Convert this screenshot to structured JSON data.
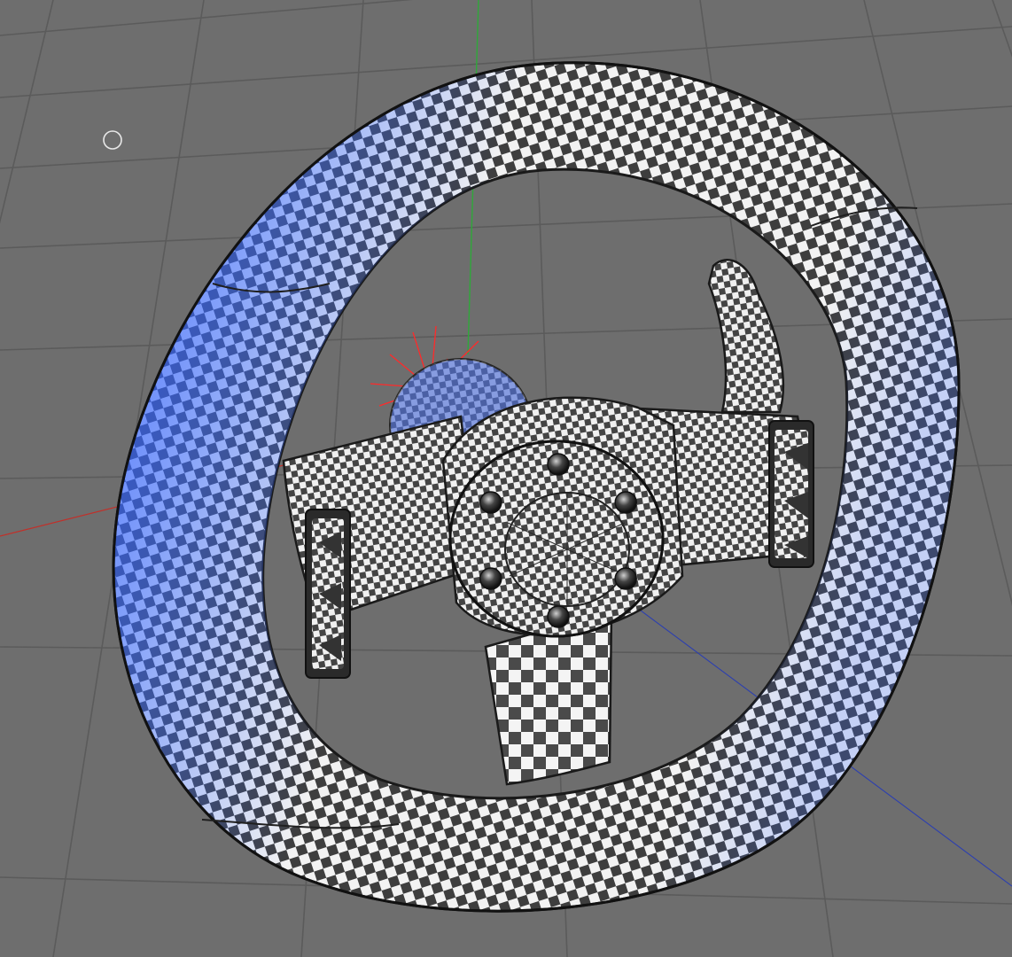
{
  "viewport": {
    "background": "#6e6e6e",
    "grid_color": "#5b5b5b",
    "axis_colors": {
      "x": "#c0302a",
      "y": "#2fa83a",
      "z": "#2c3fb0"
    },
    "light_color": "#ff2a2a",
    "cursor_icon": "circle-cursor-icon"
  },
  "model": {
    "name": "steering-wheel",
    "texture": "checker",
    "texture_colors": {
      "light": "#f2f2f2",
      "dark": "#3e3e3e"
    },
    "highlight_color": "#3a6bff",
    "bolt_count": 6
  }
}
